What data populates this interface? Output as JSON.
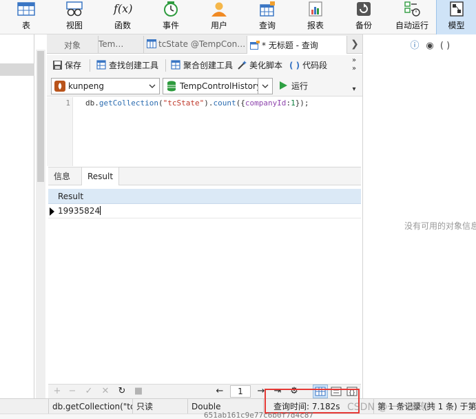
{
  "ribbon": {
    "items": [
      {
        "label": "表",
        "icon": "table-icon"
      },
      {
        "label": "视图",
        "icon": "view-icon"
      },
      {
        "label": "函数",
        "icon": "function-icon"
      },
      {
        "label": "事件",
        "icon": "event-clock-icon"
      },
      {
        "label": "用户",
        "icon": "user-icon"
      },
      {
        "label": "查询",
        "icon": "query-icon"
      },
      {
        "label": "报表",
        "icon": "report-icon"
      },
      {
        "label": "备份",
        "icon": "backup-icon"
      },
      {
        "label": "自动运行",
        "icon": "automation-icon"
      },
      {
        "label": "模型",
        "icon": "model-icon"
      }
    ],
    "function_glyph": "f(x)"
  },
  "tabs": {
    "objects": "对象",
    "tab1": "Tem…",
    "tab2": "tcState @TempCon…",
    "tab3": "* 无标题 - 查询"
  },
  "toolbar": {
    "save": "保存",
    "find_builder": "查找创建工具",
    "aggregate_builder": "聚合创建工具",
    "beautify": "美化脚本",
    "snippet": "代码段",
    "snippet_glyph": "( )",
    "run": "运行",
    "connection": "kunpeng",
    "database": "TempControlHistory"
  },
  "editor": {
    "line_number": "1",
    "code": {
      "p1": "db.",
      "p2": "getCollection",
      "p3": "(",
      "p4": "\"tcState\"",
      "p5": ").",
      "p6": "count",
      "p7": "({",
      "p8": "companyId",
      "p9": ":",
      "p10": "1",
      "p11": "});"
    }
  },
  "results": {
    "tab_info": "信息",
    "tab_result": "Result",
    "column_header": "Result",
    "row_value": "19935824",
    "page_number": "1"
  },
  "right_panel": {
    "empty_text": "没有可用的对象信息",
    "tool_icons": [
      "ⓘ",
      "◉",
      "( )"
    ]
  },
  "status_bar": {
    "query": "db.getCollection(\"tc",
    "readonly": "只读",
    "type": "Double",
    "time": "查询时间: 7.182s",
    "record": "第 1 条记录 (共 1 条) 于第"
  },
  "watermark": "CSDN @一个搬砖的",
  "underlying_text": "651ab161c9e77c6b0f7d4c87",
  "colors": {
    "accent": "#cfe3f7",
    "highlight_box": "#e53935",
    "run_green": "#2ea043"
  }
}
